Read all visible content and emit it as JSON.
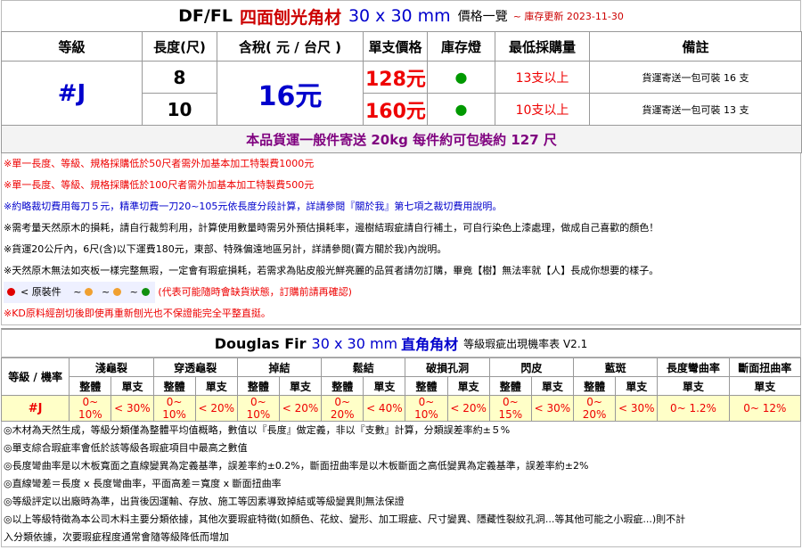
{
  "title": {
    "model": "DF/FL",
    "product": "四面刨光角材",
    "size": "30 x 30 mm",
    "price_list": "價格一覽",
    "updated": "~ 庫存更新 2023-11-30"
  },
  "price_table": {
    "headers": [
      "等級",
      "長度(尺)",
      "含稅( 元 / 台尺 )",
      "單支價格",
      "庫存燈",
      "最低採購量",
      "備註"
    ],
    "grade": "#J",
    "price_per_ft": "16元",
    "rows": [
      {
        "length": "8",
        "single_price": "128元",
        "stock": "●",
        "min_order": "13支以上",
        "remark": "貨運寄送一包可裝 16 支"
      },
      {
        "length": "10",
        "single_price": "160元",
        "stock": "●",
        "min_order": "10支以上",
        "remark": "貨運寄送一包可裝 13 支"
      }
    ],
    "shipping": "本品貨運一般件寄送 20kg 每件約可包裝約 127 尺"
  },
  "notes": [
    "※單一長度、等級、規格採購低於50尺者需外加基本加工特製費1000元",
    "※單一長度、等級、規格採購低於100尺者需外加基本加工特製費500元",
    "※約略裁切費用每刀５元，精準切費一刀20~105元依長度分段計算，詳請參閱『關於我』第七項之裁切費用說明。",
    "※需考量天然原木的損耗，請自行裁剪利用，計算使用數量時需另外預估損耗率，邊樹結瑕疵請自行補土，可自行染色上漆處理，做成自己喜歡的顏色！",
    "※貨運20公斤內，6尺(含)以下運費180元，東部、特殊偏遠地區另計，詳請參閱(賣方關於我)內說明。",
    "※天然原木無法如夾板一樣完整無瑕，一定會有瑕疵損耗，若需求為貼皮般光鮮亮麗的品質者請勿訂購，畢竟【樹】無法率就【人】長成你想要的樣子。",
    "※KD原料經剖切後即使再重新刨光也不保證能完全平整直挺。"
  ],
  "stock_legend": {
    "label": "< 原裝件",
    "sep": "~",
    "warning": "(代表可能隨時會缺貨狀態，訂購前請再確認)",
    "colors": [
      "#e00000",
      "#f0a030",
      "#f0a030",
      "#109010"
    ]
  },
  "defect_table": {
    "title": "Douglas Fir",
    "size": "30 x 30 mm",
    "subtitle_bold": "直角角材",
    "subtitle": "等級瑕疵出現機率表 V2.1",
    "corner": "等級 / 機率",
    "groups": [
      "淺龜裂",
      "穿透龜裂",
      "掉結",
      "鬆結",
      "破損孔洞",
      "閃皮",
      "藍斑",
      "長度彎曲率",
      "斷面扭曲率"
    ],
    "sub": {
      "whole": "整體",
      "single": "單支"
    },
    "row": {
      "grade": "#J",
      "values": [
        "0~ 10%",
        "< 30%",
        "0~ 10%",
        "< 20%",
        "0~ 10%",
        "< 20%",
        "0~ 20%",
        "< 40%",
        "0~ 10%",
        "< 20%",
        "0~ 15%",
        "< 30%",
        "0~ 20%",
        "< 30%",
        "0~ 1.2%",
        "0~ 12%"
      ]
    }
  },
  "defect_notes": [
    "◎木材為天然生成，等級分類僅為整體平均值概略，數值以『長度』做定義，非以『支數』計算，分類誤差率約±５%",
    "◎單支綜合瑕疵率會低於該等級各瑕疵項目中最高之數值",
    "◎長度彎曲率是以木板寬面之直線變異為定義基準，誤差率約±0.2%，斷面扭曲率是以木板斷面之高低變異為定義基準，誤差率約±2%",
    "◎直線彎差＝長度 x 長度彎曲率，平面高差＝寬度 x 斷面扭曲率",
    "◎等級評定以出廠時為準，出貨後因運輸、存放、施工等因素導致掉結或等級變異則無法保證",
    "◎以上等級特徵為本公司木料主要分類依據，其他次要瑕疵特徵(如顏色、花紋、變形、加工瑕疵、尺寸變異、隱藏性裂紋孔洞...等其他可能之小瑕疵...)則不計",
    "入分類依據，次要瑕疵程度通常會隨等級降低而增加"
  ]
}
